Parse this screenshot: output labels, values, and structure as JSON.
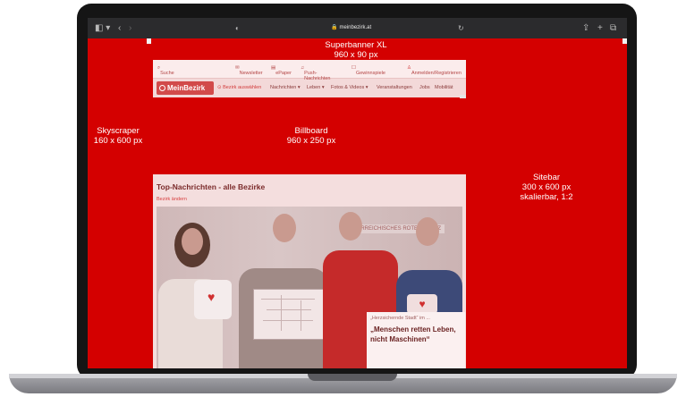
{
  "browser": {
    "url": "meinbezirk.at"
  },
  "ads": {
    "superbanner": {
      "name": "Superbanner XL",
      "size": "960 x 90 px"
    },
    "skyscraper": {
      "name": "Skyscraper",
      "size": "160 x 600 px"
    },
    "billboard": {
      "name": "Billboard",
      "size": "960 x 250 px"
    },
    "sitebar": {
      "name": "Sitebar",
      "size": "300 x 600 px",
      "note": "skalierbar, 1:2"
    }
  },
  "site": {
    "search_label": "Suche",
    "top_links": [
      "Newsletter",
      "ePaper",
      "Push-Nachrichten",
      "Gewinnspiele"
    ],
    "login_label": "Anmelden/Registrieren",
    "logo_text": "MeinBezirk",
    "region_label": "Bezirk auswählen",
    "nav_items": [
      "Nachrichten ▾",
      "Leben ▾",
      "Fotos & Videos ▾",
      "Veranstaltungen",
      "Jobs",
      "Mobilität"
    ]
  },
  "content": {
    "title": "Top-Nachrichten - alle Bezirke",
    "link": "Bezirk ändern",
    "sign_text": "ÖSTERREICHISCHES ROTES KREUZ",
    "teaser_sub": "„Herzsichernde Stadt“ im ...",
    "teaser_headline": "„Menschen retten Leben, nicht Maschinen“"
  },
  "colors": {
    "screen_bg": "#d40000",
    "browser_bar": "#2b2b2d",
    "laptop_frame": "#151515"
  }
}
